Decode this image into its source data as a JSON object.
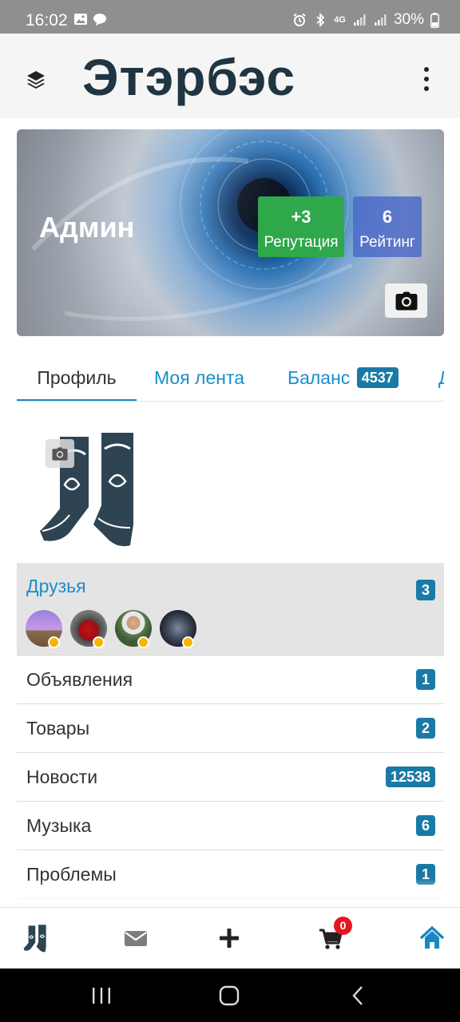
{
  "status_bar": {
    "time": "16:02",
    "battery": "30%",
    "network": "4G",
    "icons": [
      "image-icon",
      "chat-bubble-icon",
      "alarm-icon",
      "bluetooth-icon",
      "signal-icon",
      "signal-icon",
      "battery-icon"
    ]
  },
  "header": {
    "logo": "Этэрбэс",
    "menu_icon": "layers-icon",
    "more_icon": "kebab-icon"
  },
  "profile": {
    "name": "Админ",
    "reputation_value": "+3",
    "reputation_label": "Репутация",
    "rating_value": "6",
    "rating_label": "Рейтинг",
    "colors": {
      "reputation_bg": "#2ea84a",
      "rating_bg": "#4a68c8"
    }
  },
  "tabs": [
    {
      "label": "Профиль",
      "active": true
    },
    {
      "label": "Моя лента"
    },
    {
      "label": "Баланс",
      "badge": "4537"
    },
    {
      "label": "Д"
    }
  ],
  "friends": {
    "title": "Друзья",
    "count": "3",
    "avatars": [
      "friend-avatar-1",
      "friend-avatar-2",
      "friend-avatar-3",
      "friend-avatar-4"
    ]
  },
  "sections": [
    {
      "label": "Объявления",
      "count": "1"
    },
    {
      "label": "Товары",
      "count": "2"
    },
    {
      "label": "Новости",
      "count": "12538"
    },
    {
      "label": "Музыка",
      "count": "6"
    },
    {
      "label": "Проблемы",
      "count": "1"
    }
  ],
  "bottom_nav": {
    "items": [
      "profile-avatar-icon",
      "mail-icon",
      "plus-icon",
      "cart-icon",
      "home-icon"
    ],
    "cart_count": "0",
    "active_color": "#1a88c0"
  },
  "colors": {
    "accent": "#1890c9",
    "badge": "#1a7aa6",
    "online": "#f6b400"
  }
}
